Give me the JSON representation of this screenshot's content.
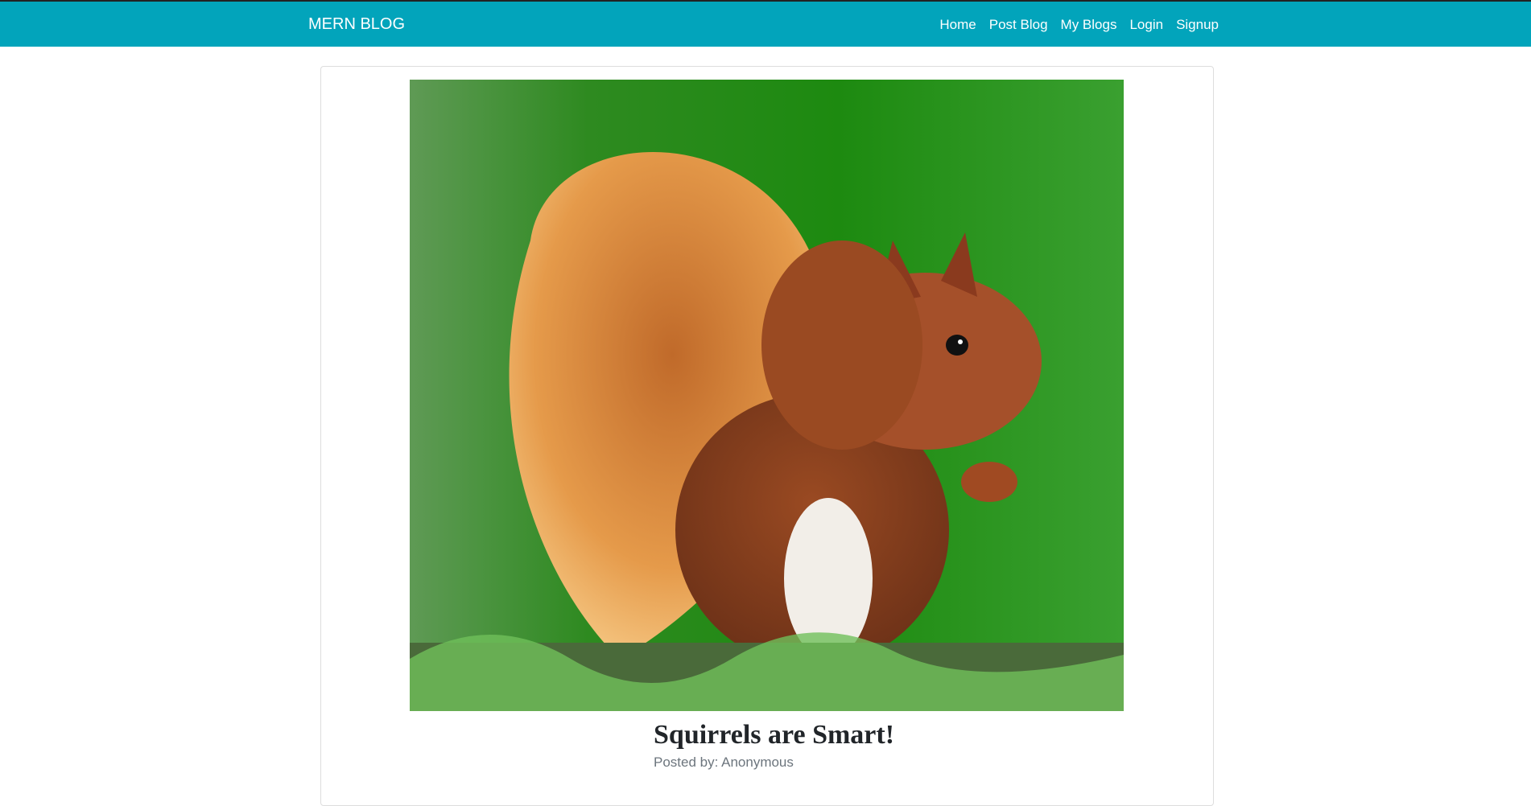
{
  "navbar": {
    "brand": "MERN BLOG",
    "links": [
      "Home",
      "Post Blog",
      "My Blogs",
      "Login",
      "Signup"
    ],
    "color": "#02a4bb"
  },
  "post": {
    "image_alt": "Red squirrel eating",
    "title": "Squirrels are Smart!",
    "posted_by": "Posted by: Anonymous"
  }
}
